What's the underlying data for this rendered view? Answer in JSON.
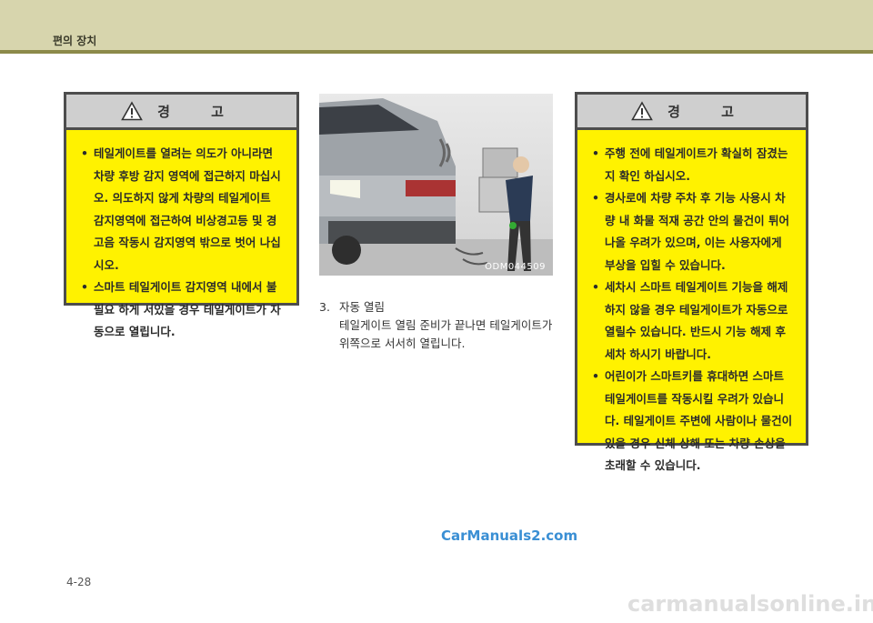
{
  "header": {
    "section_title": "편의 장치"
  },
  "warning_left": {
    "title": "경 고",
    "items": [
      "테일게이트를 열려는 의도가 아니라면 차량 후방 감지 영역에 접근하지 마십시오. 의도하지 않게 차량의 테일게이트 감지영역에 접근하여 비상경고등 및 경고음 작동시 감지영역 밖으로 벗어 나십시오.",
      "스마트 테일게이트 감지영역 내에서 불필요 하게 서있을 경우 테일게이트가 자동으로 열립니다."
    ]
  },
  "photo": {
    "code": "ODM044509"
  },
  "step": {
    "number": "3.",
    "title": "자동 열림",
    "body": "테일게이트 열림 준비가 끝나면 테일게이트가 위쪽으로 서서히 열립니다."
  },
  "warning_right": {
    "title": "경 고",
    "items": [
      "주행 전에 테일게이트가 확실히 잠겼는지 확인 하십시오.",
      "경사로에 차량 주차 후 기능 사용시 차량 내 화물 적재 공간 안의 물건이 튀어나올 우려가 있으며, 이는 사용자에게 부상을 입힐 수 있습니다.",
      "세차시 스마트 테일게이트 기능을 해제하지 않을 경우 테일게이트가 자동으로 열릴수 있습니다. 반드시 기능 해제 후 세차 하시기 바랍니다.",
      "어린이가 스마트키를 휴대하면 스마트 테일게이트를 작동시킬 우려가 있습니다. 테일게이트 주변에 사람이나 물건이 있을 경우 신체 상해 또는 차량 손상을 초래할 수 있습니다."
    ]
  },
  "footer": {
    "watermark": "CarManuals2.com",
    "page_number": "4-28",
    "site": "carmanualsonline.info"
  }
}
